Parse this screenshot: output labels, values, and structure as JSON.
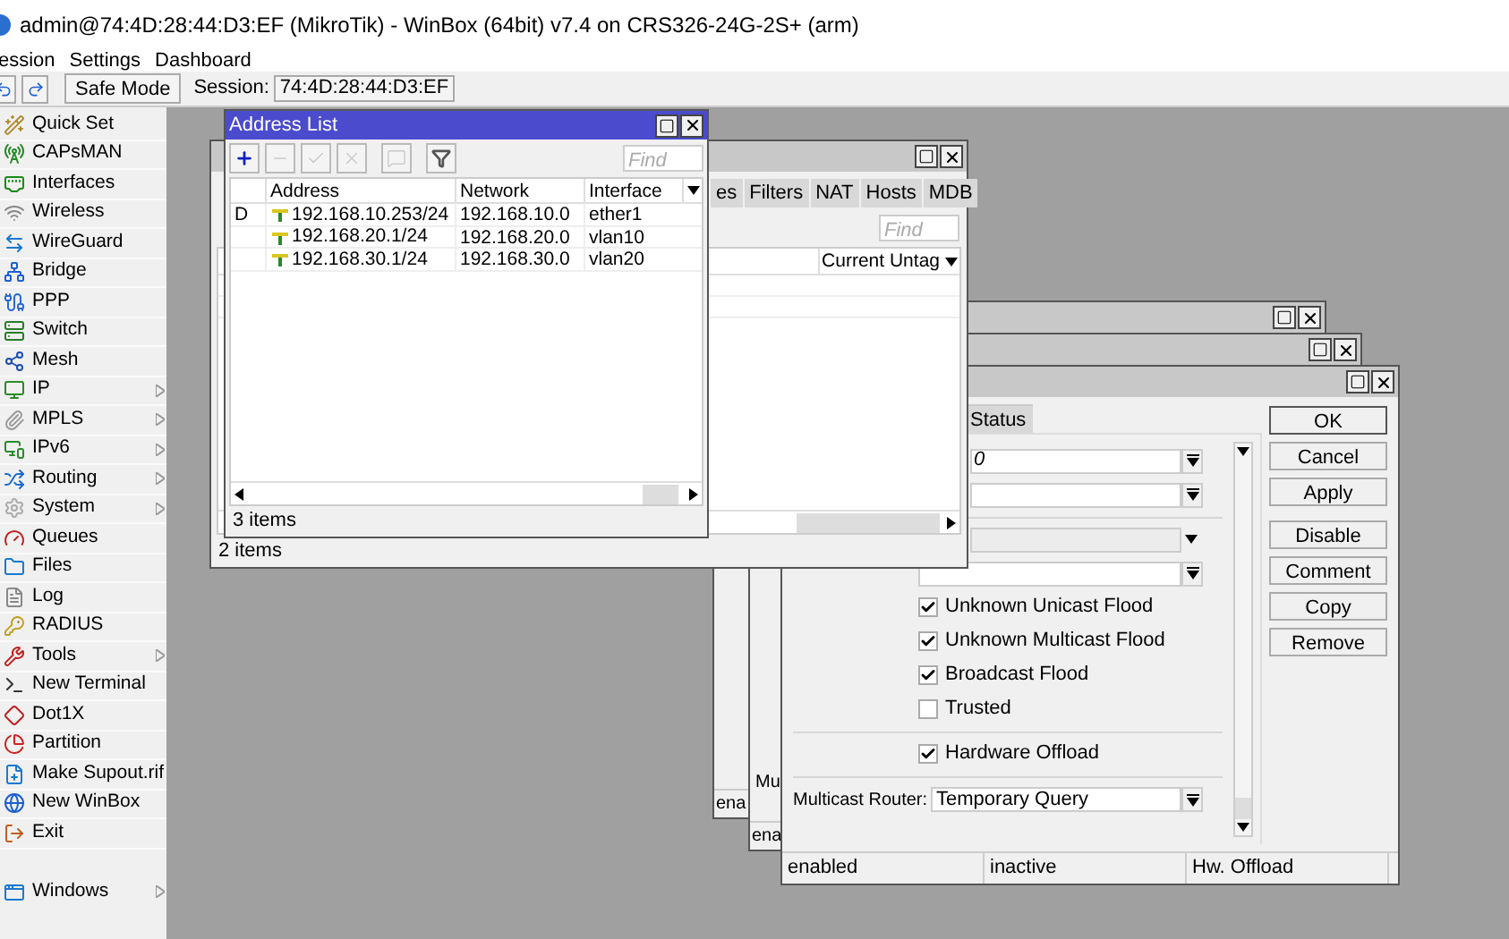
{
  "window": {
    "title": "admin@74:4D:28:44:D3:EF (MikroTik) - WinBox (64bit) v7.4 on CRS326-24G-2S+ (arm)"
  },
  "menu": [
    "ession",
    "Settings",
    "Dashboard"
  ],
  "toolbar": {
    "buttons": [
      {
        "kind": "undo"
      },
      {
        "kind": "redo"
      }
    ],
    "safe_mode": "Safe Mode",
    "session_label": "Session:",
    "session_value": "74:4D:28:44:D3:EF"
  },
  "sidebar": {
    "items": [
      {
        "label": "Quick Set",
        "has_submenu": false
      },
      {
        "label": "CAPsMAN",
        "has_submenu": false
      },
      {
        "label": "Interfaces",
        "has_submenu": false
      },
      {
        "label": "Wireless",
        "has_submenu": false
      },
      {
        "label": "WireGuard",
        "has_submenu": false
      },
      {
        "label": "Bridge",
        "has_submenu": false
      },
      {
        "label": "PPP",
        "has_submenu": false
      },
      {
        "label": "Switch",
        "has_submenu": false
      },
      {
        "label": "Mesh",
        "has_submenu": false
      },
      {
        "label": "IP",
        "has_submenu": true
      },
      {
        "label": "MPLS",
        "has_submenu": true
      },
      {
        "label": "IPv6",
        "has_submenu": true
      },
      {
        "label": "Routing",
        "has_submenu": true
      },
      {
        "label": "System",
        "has_submenu": true
      },
      {
        "label": "Queues",
        "has_submenu": false
      },
      {
        "label": "Files",
        "has_submenu": false
      },
      {
        "label": "Log",
        "has_submenu": false
      },
      {
        "label": "RADIUS",
        "has_submenu": false
      },
      {
        "label": "Tools",
        "has_submenu": true
      },
      {
        "label": "New Terminal",
        "has_submenu": false
      },
      {
        "label": "Dot1X",
        "has_submenu": false
      },
      {
        "label": "Partition",
        "has_submenu": false
      },
      {
        "label": "Make Supout.rif",
        "has_submenu": false
      },
      {
        "label": "New WinBox",
        "has_submenu": false
      },
      {
        "label": "Exit",
        "has_submenu": false
      }
    ],
    "bottom_items": [
      {
        "label": "Windows",
        "has_submenu": true
      }
    ]
  },
  "bridge_window": {
    "tabs": [
      "es",
      "Filters",
      "NAT",
      "Hosts",
      "MDB"
    ],
    "find_placeholder": "Find",
    "column": "Current Untag",
    "status": "2 items"
  },
  "port_windows": [
    {
      "status": "ena"
    },
    {
      "field_label": "Mu",
      "status": "ena"
    }
  ],
  "port_dialog": {
    "tab": "Status",
    "rows": [
      {
        "kind": "field",
        "value": "0"
      },
      {
        "kind": "field"
      },
      {
        "kind": "separator"
      },
      {
        "kind": "select",
        "disabled": true
      },
      {
        "kind": "field"
      },
      {
        "kind": "checkbox",
        "label": "Unknown Unicast Flood",
        "checked": true
      },
      {
        "kind": "checkbox",
        "label": "Unknown Multicast Flood",
        "checked": true
      },
      {
        "kind": "checkbox",
        "label": "Broadcast Flood",
        "checked": true
      },
      {
        "kind": "checkbox",
        "label": "Trusted",
        "checked": false
      },
      {
        "kind": "separator"
      },
      {
        "kind": "checkbox",
        "label": "Hardware Offload",
        "checked": true
      },
      {
        "kind": "separator"
      },
      {
        "kind": "labeled_field",
        "label": "Multicast Router:",
        "value": "Temporary Query"
      }
    ],
    "buttons": [
      "OK",
      "Cancel",
      "Apply",
      "Disable",
      "Comment",
      "Copy",
      "Remove"
    ],
    "status_bar": [
      "enabled",
      "inactive",
      "Hw. Offload"
    ]
  },
  "address_list": {
    "title": "Address List",
    "tools": [
      {
        "kind": "add",
        "disabled": false
      },
      {
        "kind": "remove",
        "disabled": true
      },
      {
        "kind": "enable",
        "disabled": true
      },
      {
        "kind": "disable",
        "disabled": true
      },
      {
        "kind": "comment",
        "disabled": true
      },
      {
        "kind": "filter",
        "disabled": false
      }
    ],
    "find_placeholder": "Find",
    "columns": [
      "Address",
      "Network",
      "Interface"
    ],
    "rows": [
      {
        "flag": "D",
        "address": "192.168.10.253/24",
        "network": "192.168.10.0",
        "interface": "ether1"
      },
      {
        "address": "192.168.20.1/24",
        "network": "192.168.20.0",
        "interface": "vlan10"
      },
      {
        "address": "192.168.30.1/24",
        "network": "192.168.30.0",
        "interface": "vlan20"
      }
    ],
    "status": "3 items"
  }
}
